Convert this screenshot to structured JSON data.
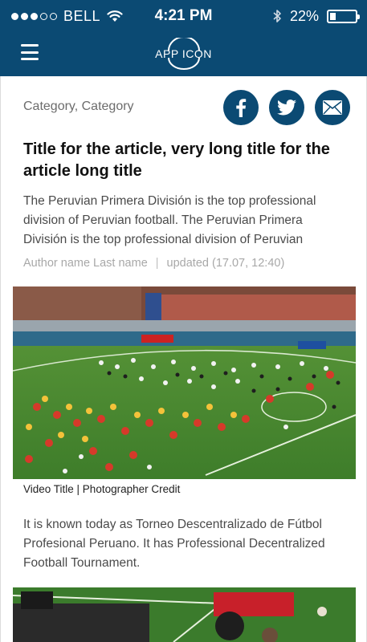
{
  "status_bar": {
    "carrier": "BELL",
    "time": "4:21 PM",
    "battery": "22%",
    "battery_level": 0.22,
    "signal_bars_filled": 3,
    "signal_bars_total": 5
  },
  "header": {
    "app_icon_label": "APP ICON",
    "brand_color": "#0b4a73"
  },
  "article": {
    "categories": "Category, Category",
    "title": "Title for the article, very long title for the article long title",
    "summary": "The Peruvian Primera División is the top professional division of Peruvian football. The Peruvian Primera División is the top professional division of Peruvian",
    "author": "Author name Last name",
    "separator": "|",
    "updated": "updated (17.07, 12:40)",
    "media_caption": "Video Title | Photographer Credit",
    "body": "It is known today as Torneo Descentralizado de Fútbol Profesional Peruano. It has Professional Decentralized Football Tournament."
  },
  "share": {
    "icons": [
      "facebook-icon",
      "twitter-icon",
      "mail-icon"
    ]
  }
}
